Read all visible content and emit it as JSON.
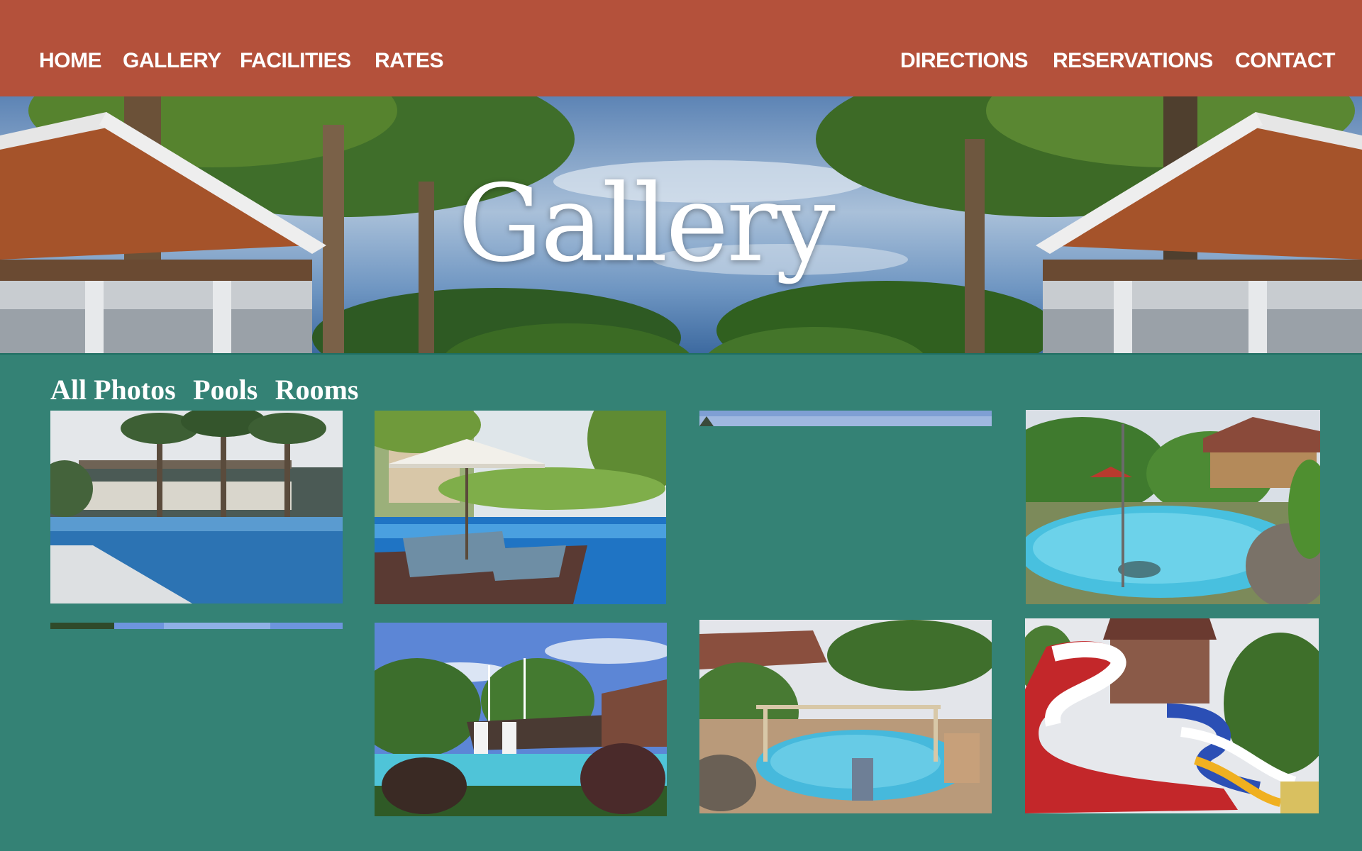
{
  "nav": {
    "left": [
      "HOME",
      "GALLERY",
      "FACILITIES",
      "RATES"
    ],
    "right": [
      "DIRECTIONS",
      "RESERVATIONS",
      "CONTACT"
    ]
  },
  "hero": {
    "title": "Gallery"
  },
  "filters": [
    "All Photos",
    "Pools",
    "Rooms"
  ],
  "gallery": {
    "photos": [
      {
        "subject": "hotel pool with palm trees",
        "loaded": true
      },
      {
        "subject": "pool deck with umbrella and loungers",
        "loaded": true
      },
      {
        "subject": "sky strip",
        "loaded": false
      },
      {
        "subject": "lagoon pool with nipa huts",
        "loaded": true
      },
      {
        "subject": "sky strip",
        "loaded": false
      },
      {
        "subject": "pirate ship pool with slides",
        "loaded": true
      },
      {
        "subject": "pool with bamboo trellis and ladder",
        "loaded": true
      },
      {
        "subject": "red and white water slide tower",
        "loaded": true
      }
    ]
  },
  "colors": {
    "nav_bg": "#b4513b",
    "page_bg": "#348275",
    "text": "#ffffff"
  }
}
